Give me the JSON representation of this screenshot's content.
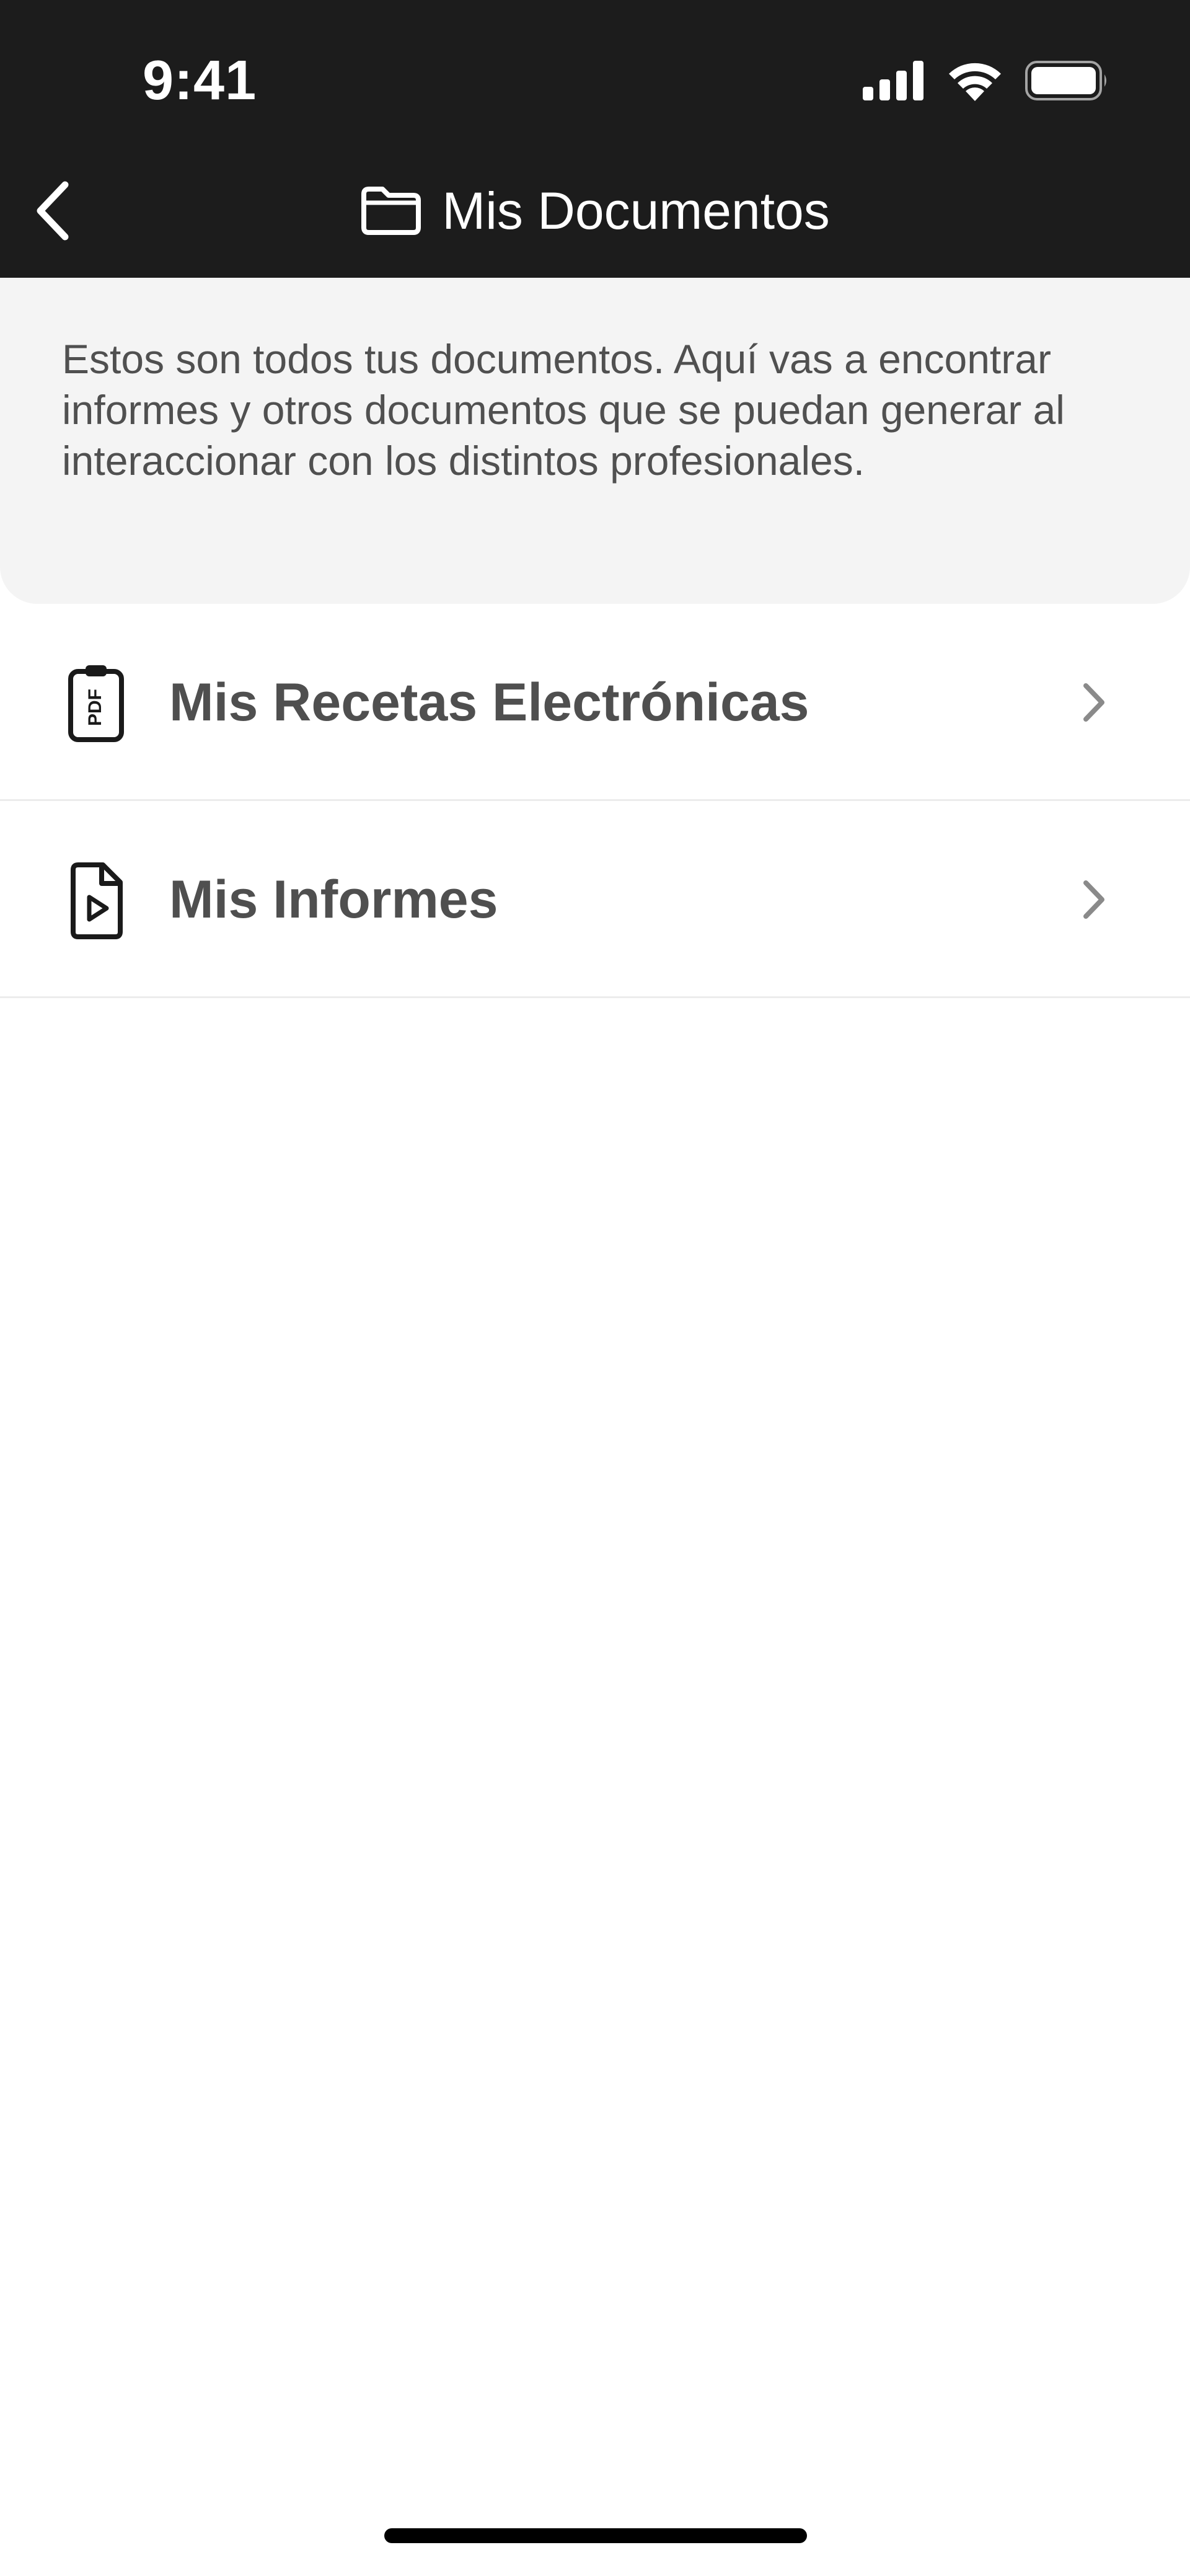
{
  "status_bar": {
    "time": "9:41",
    "icons": [
      "cellular-signal-icon",
      "wifi-icon",
      "battery-icon"
    ]
  },
  "nav": {
    "back_icon": "chevron-left-icon",
    "title_icon": "folder-icon",
    "title": "Mis Documentos"
  },
  "intro": {
    "text": "Estos son todos tus documentos. Aquí vas a encontrar informes y otros documentos que se puedan generar al interaccionar con los distintos profesionales."
  },
  "list": {
    "items": [
      {
        "label": "Mis Recetas Electrónicas",
        "icon": "pdf-clipboard-icon"
      },
      {
        "label": "Mis Informes",
        "icon": "file-play-icon"
      }
    ]
  },
  "colors": {
    "header_bg": "#1c1c1c",
    "intro_bg": "#f4f4f4",
    "text_primary": "#4f4f4f",
    "divider": "#ececec"
  }
}
